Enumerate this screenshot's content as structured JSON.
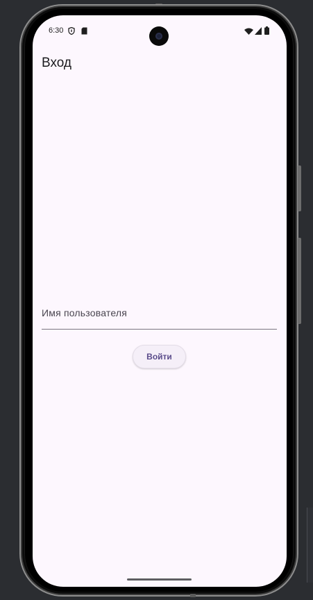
{
  "status_bar": {
    "time": "6:30",
    "left_icons": [
      "shield-icon",
      "sd-card-icon"
    ],
    "right_icons": [
      "wifi-icon",
      "signal-icon",
      "battery-icon"
    ]
  },
  "app": {
    "title": "Вход"
  },
  "login_form": {
    "username_placeholder": "Имя пользователя",
    "username_value": "",
    "submit_label": "Войти"
  },
  "colors": {
    "screen_background": "#fdf7fe",
    "button_text": "#5a4b8a",
    "button_background": "#f5eff8"
  }
}
